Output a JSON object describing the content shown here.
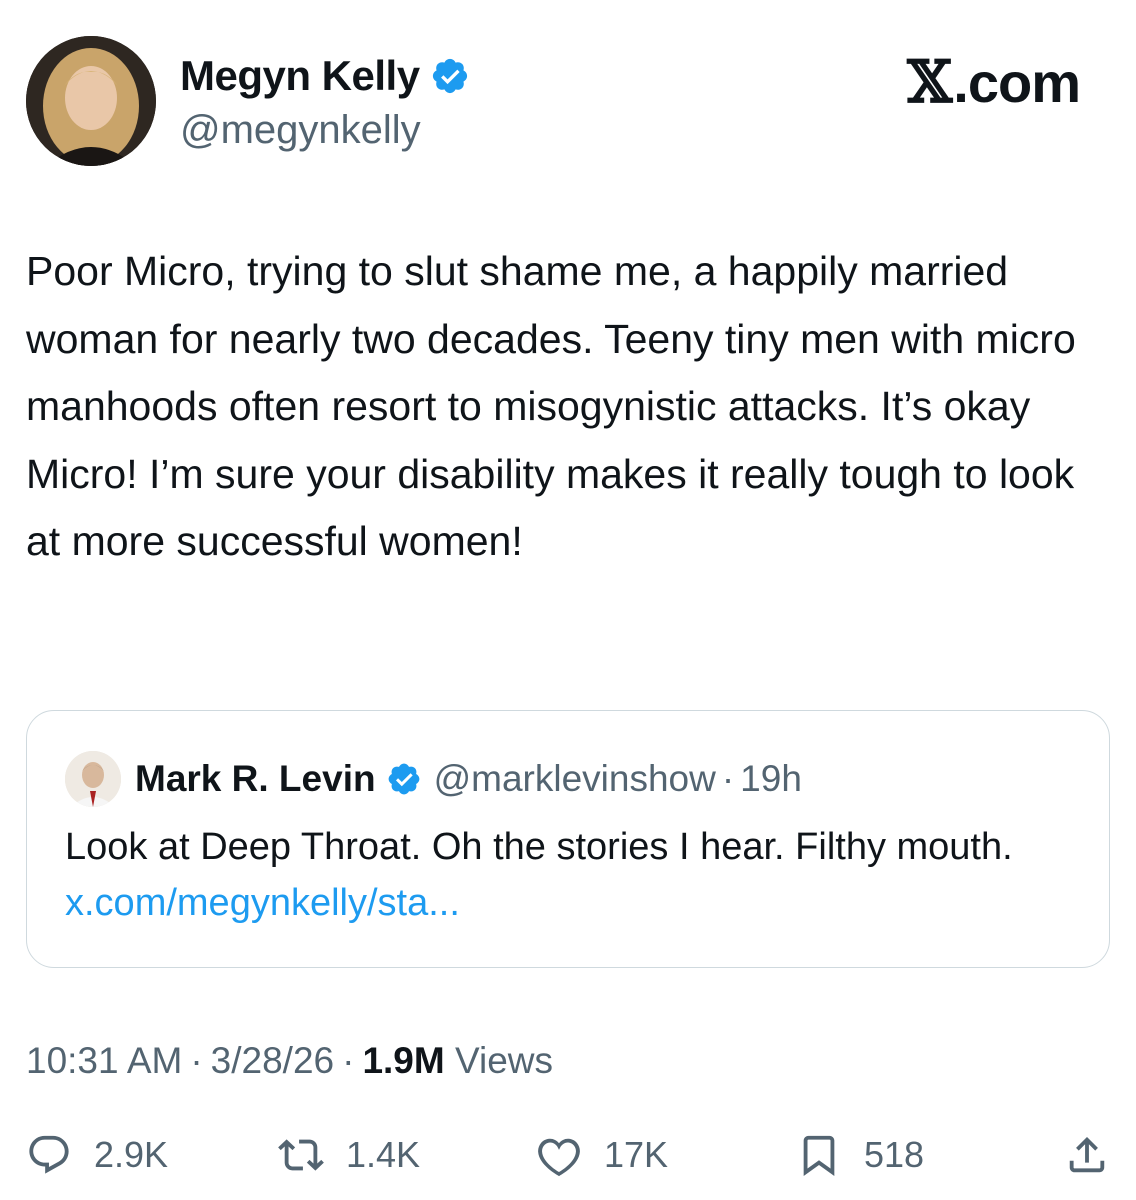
{
  "author": {
    "name": "Megyn Kelly",
    "handle": "@megynkelly",
    "verified_badge_icon": "verified-badge-icon"
  },
  "site_logo": {
    "x_glyph": "𝕏",
    "text": ".com"
  },
  "tweet": {
    "text": "Poor Micro, trying to slut shame me, a happily married woman for nearly two decades. Teeny tiny men with micro manhoods often resort to misogynistic attacks. It’s okay Micro! I’m sure your disability makes it really tough to look at more successful women!"
  },
  "quoted_tweet": {
    "author_name": "Mark R. Levin",
    "handle": "@marklevinshow",
    "separator": "·",
    "time": "19h",
    "text": "Look at Deep Throat. Oh the stories I hear.  Filthy mouth.",
    "link": "x.com/megynkelly/sta..."
  },
  "meta": {
    "time": "10:31 AM",
    "date": "3/28/26",
    "separator": "·",
    "views_count": "1.9M",
    "views_label": "Views"
  },
  "actions": {
    "replies": "2.9K",
    "reposts": "1.4K",
    "likes": "17K",
    "bookmarks": "518"
  },
  "colors": {
    "text": "#0f1419",
    "secondary": "#536471",
    "link": "#1d9bf0",
    "verified": "#1d9bf0",
    "border": "#cfd9de"
  }
}
